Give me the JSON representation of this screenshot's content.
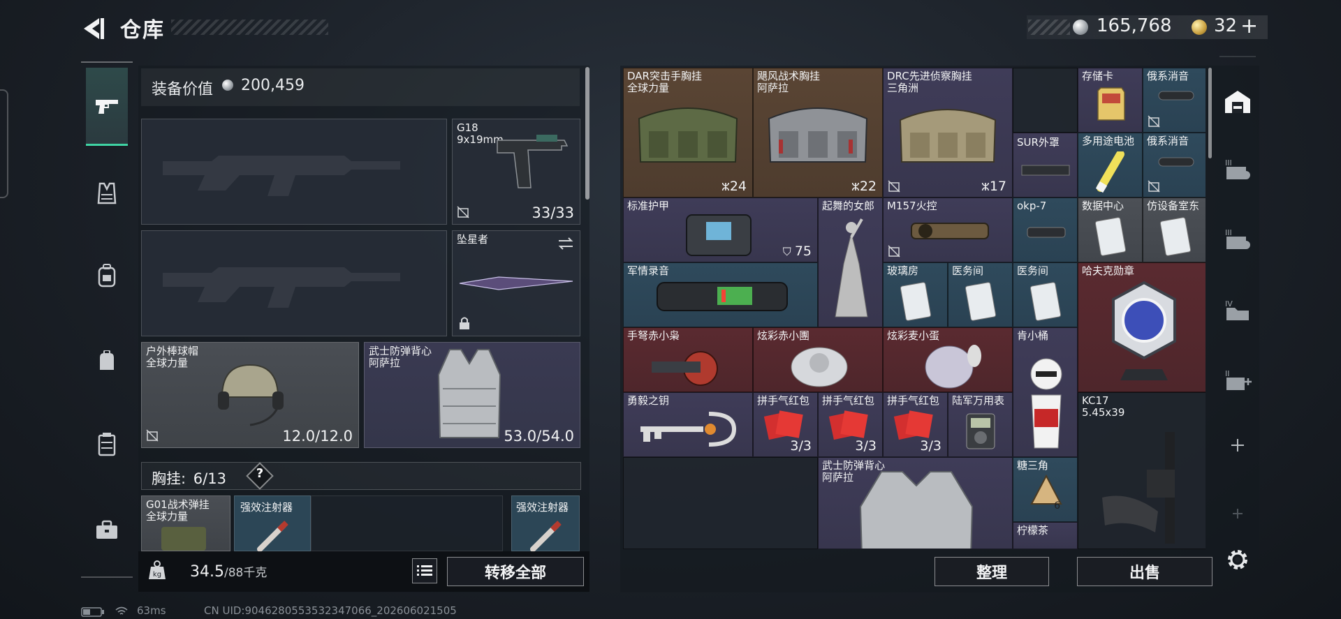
{
  "header": {
    "title": "仓库",
    "silver_amount": "165,768",
    "gold_amount": "32",
    "gold_plus": "+"
  },
  "left_panel": {
    "equip_value_label": "装备价值",
    "equip_value": "200,459",
    "sidearm": {
      "name": "G18",
      "ammo": "9x19mm",
      "count": "33/33"
    },
    "melee": {
      "name": "坠星者"
    },
    "helmet": {
      "name": "户外棒球帽",
      "faction": "全球力量",
      "durability": "12.0/12.0"
    },
    "armor": {
      "name": "武士防弹背心",
      "faction": "阿萨拉",
      "durability": "53.0/54.0"
    },
    "chest_rig": {
      "label": "胸挂:",
      "capacity": "6/13",
      "help": "?"
    },
    "rig_items": [
      {
        "name": "G01战术弹挂",
        "faction": "全球力量"
      },
      {
        "name": "强效注射器"
      },
      {
        "name": "强效注射器"
      }
    ],
    "weight": "34.5",
    "weight_max": "/88千克",
    "transfer_all": "转移全部"
  },
  "stash": {
    "items": [
      {
        "name": "DAR突击手胸挂",
        "sub": "全球力量",
        "count": "24"
      },
      {
        "name": "飓风战术胸挂",
        "sub": "阿萨拉",
        "count": "22"
      },
      {
        "name": "DRC先进侦察胸挂",
        "sub": "三角洲",
        "count": "17"
      },
      {
        "name": "存储卡"
      },
      {
        "name": "俄系消音"
      },
      {
        "name": "SUR外罩"
      },
      {
        "name": "多用途电池"
      },
      {
        "name": "俄系消音"
      },
      {
        "name": "标准护甲",
        "count": "75"
      },
      {
        "name": "起舞的女郎"
      },
      {
        "name": "M157火控"
      },
      {
        "name": "okp-7"
      },
      {
        "name": "数据中心"
      },
      {
        "name": "仿设备室东"
      },
      {
        "name": "军情录音"
      },
      {
        "name": "玻璃房"
      },
      {
        "name": "医务间"
      },
      {
        "name": "医务间"
      },
      {
        "name": "哈夫克勋章"
      },
      {
        "name": "手弩赤小枭"
      },
      {
        "name": "炫彩赤小團"
      },
      {
        "name": "炫彩麦小蛋"
      },
      {
        "name": "肯小桶"
      },
      {
        "name": "勇毅之钥"
      },
      {
        "name": "拼手气红包",
        "count": "3/3"
      },
      {
        "name": "拼手气红包",
        "count": "3/3"
      },
      {
        "name": "拼手气红包",
        "count": "3/3"
      },
      {
        "name": "陆军万用表"
      },
      {
        "name": "KC17",
        "sub": "5.45x39"
      },
      {
        "name": "武士防弹背心",
        "sub": "阿萨拉"
      },
      {
        "name": "糖三角",
        "count": "6"
      },
      {
        "name": "柠檬茶"
      }
    ],
    "sort_label": "整理",
    "sell_label": "出售"
  },
  "status_bar": {
    "ping": "63ms",
    "uid": "CN UID:9046280553532347066_202606021505"
  }
}
